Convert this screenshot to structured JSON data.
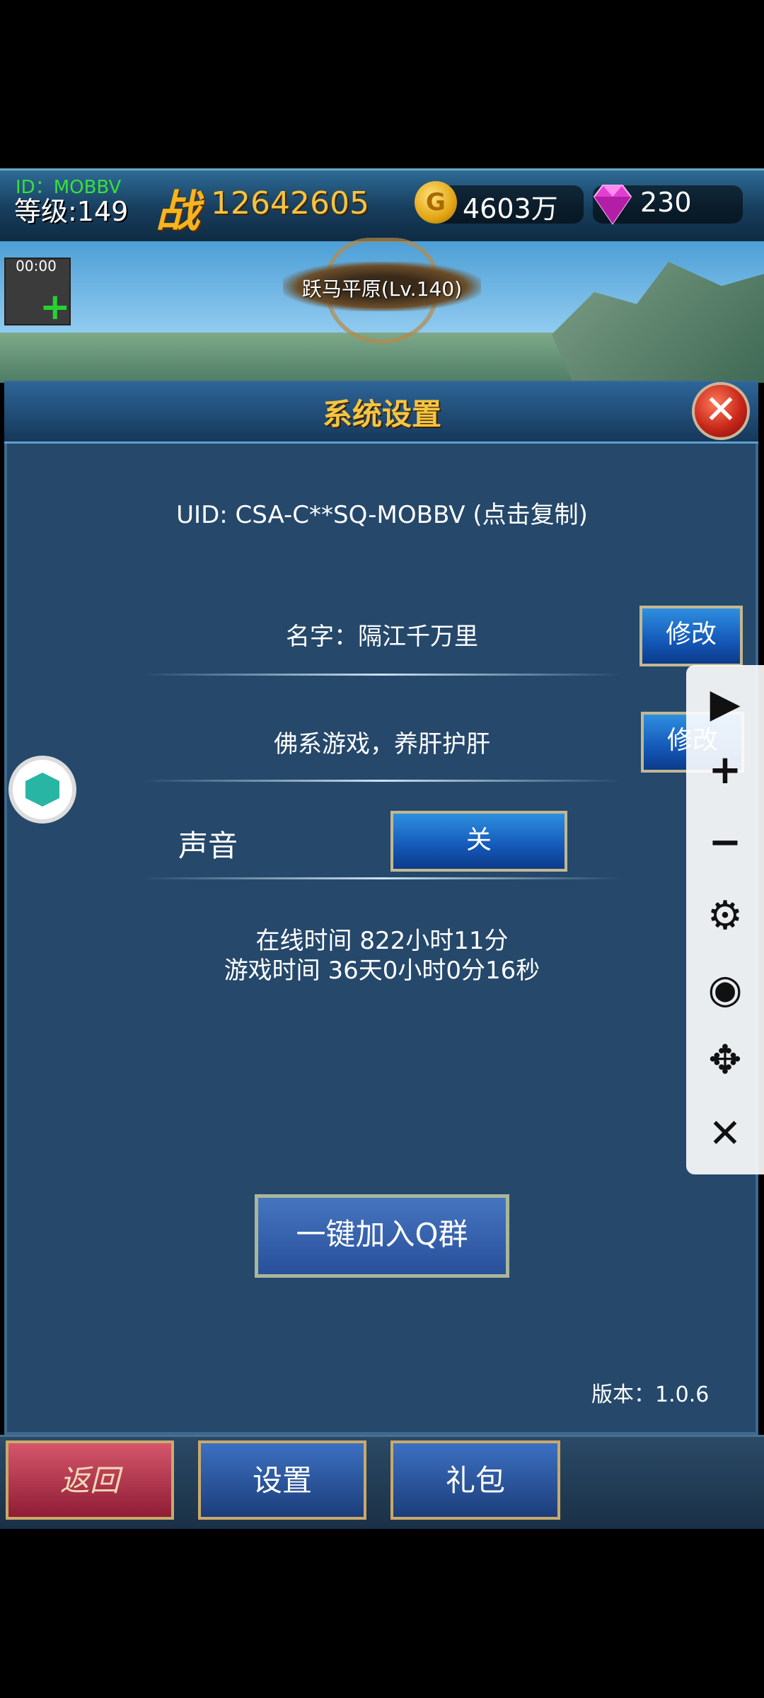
{
  "hud": {
    "id": "ID：MOBBV",
    "level": "等级:149",
    "zhan": "战",
    "power": "12642605",
    "gold_symbol": "G",
    "gold": "4603万",
    "gems": "230"
  },
  "scene": {
    "timer": "00:00",
    "plus": "+",
    "map_name": "跃马平原(Lv.140)"
  },
  "panel": {
    "title": "系统设置",
    "close": "✕",
    "uid": "UID: CSA-C**SQ-MOBBV (点击复制)",
    "name_label": "名字：隔江千万里",
    "edit_label": "修改",
    "motto": "佛系游戏，养肝护肝",
    "sound_label": "声音",
    "sound_value": "关",
    "online_time": "在线时间 822小时11分",
    "play_time": "游戏时间 36天0小时0分16秒",
    "qq_button": "一键加入Q群",
    "version": "版本：1.0.6"
  },
  "toolbar": {
    "play": "▶",
    "zoom_in": "+",
    "zoom_out": "−",
    "settings": "⚙",
    "eye": "◉",
    "move": "✥",
    "close": "✕"
  },
  "bottom": {
    "back": "返回",
    "settings": "设置",
    "gift": "礼包"
  },
  "colors": {
    "panel_bg": "#25486b",
    "title_gold": "#f4c542",
    "id_green": "#37e03c",
    "power_gold": "#f6c33e"
  }
}
